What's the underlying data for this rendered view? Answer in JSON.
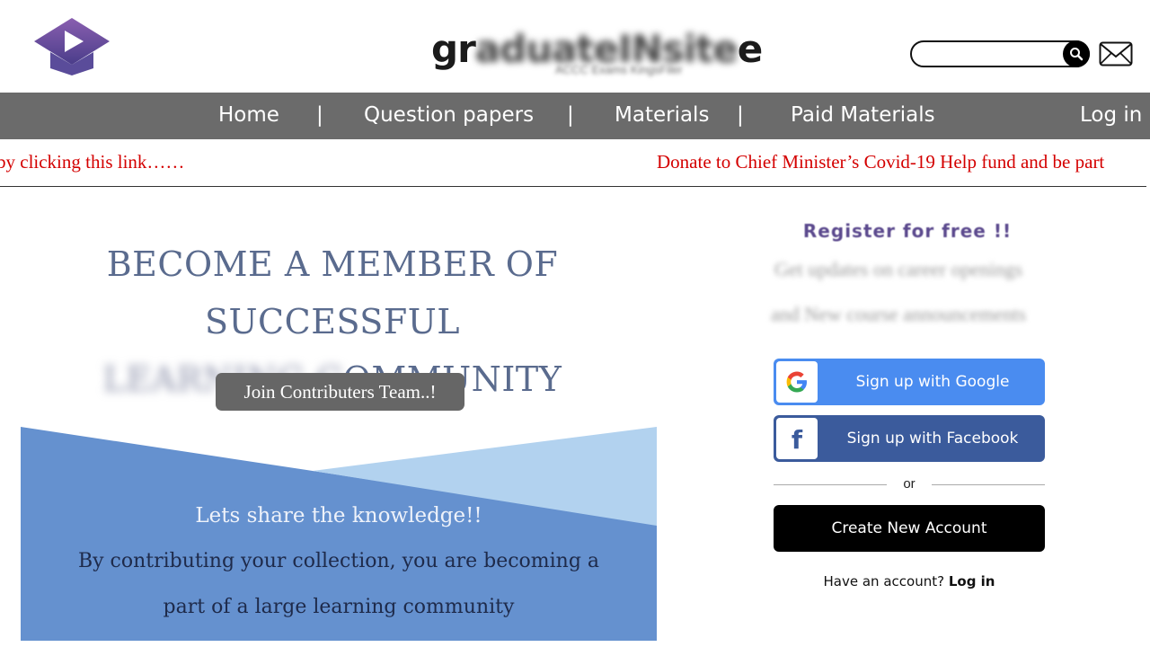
{
  "header": {
    "brand_prefix": "gr",
    "brand_blurred": "aduateINsite",
    "brand_suffix": "e",
    "brand_subtitle": "ACCC Exams KingsFiler",
    "search": {
      "value": "",
      "placeholder": ""
    },
    "icons": {
      "logo": "graduation-cap-logo",
      "search": "search-icon",
      "mail": "mail-icon"
    }
  },
  "nav": {
    "items": [
      "Home",
      "Question papers",
      "Materials",
      "Paid Materials"
    ],
    "separator": "|",
    "login": "Log in"
  },
  "marquee": {
    "text_left": "by clicking this link……",
    "text_right": "Donate to Chief Minister’s Covid-19 Help fund and be part"
  },
  "hero": {
    "title_line1": "BECOME A MEMBER OF SUCCESSFUL",
    "title_blurred": "LEARNING C",
    "title_line2": "OMMUNITY",
    "join_button": "Join Contributers Team..!",
    "share_line": "Lets share the knowledge!!",
    "body_line1": "By contributing your collection, you are becoming a",
    "body_line2": "part of a large learning community"
  },
  "register": {
    "title": "Register for free !!",
    "sub1": "Get updates on career openings",
    "sub2": "and New course announcements",
    "google_button": "Sign up with Google",
    "facebook_button": "Sign up with Facebook",
    "or": "or",
    "create_button": "Create New Account",
    "have_account": "Have an account?",
    "login_link": "Log in"
  },
  "colors": {
    "nav_bg": "#6b6b6b",
    "marquee_text": "#d40000",
    "hero_title": "#5a6b8e",
    "hero_dark_blue": "#6591cf",
    "hero_light_blue": "#b2d2ef",
    "google_blue": "#4a8cf0",
    "facebook_blue": "#3b5b9c",
    "create_black": "#000000"
  }
}
